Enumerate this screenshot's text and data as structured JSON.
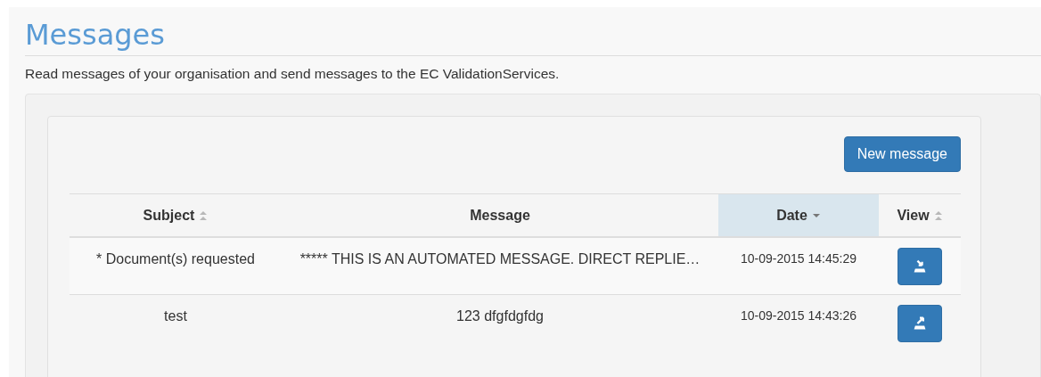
{
  "page": {
    "title": "Messages",
    "description": "Read messages of your organisation and send messages to the EC ValidationServices."
  },
  "new_message_button": {
    "label": "New message"
  },
  "table": {
    "columns": [
      {
        "label": "Subject",
        "kind": "sortable",
        "selected": false
      },
      {
        "label": "Message",
        "kind": "plain",
        "selected": false
      },
      {
        "label": "Date",
        "kind": "descending",
        "selected": true
      },
      {
        "label": "View",
        "kind": "sortable",
        "selected": false
      }
    ],
    "rows": [
      {
        "subject": "* Document(s) requested",
        "message": "***** THIS IS AN AUTOMATED MESSAGE. DIRECT REPLIE…",
        "date": "10-09-2015 14:45:29",
        "view": {
          "kind": "incoming"
        }
      },
      {
        "subject": "test",
        "message": "123 dfgfdgfdg",
        "date": "10-09-2015 14:43:26",
        "view": {
          "kind": "outgoing"
        }
      }
    ]
  }
}
